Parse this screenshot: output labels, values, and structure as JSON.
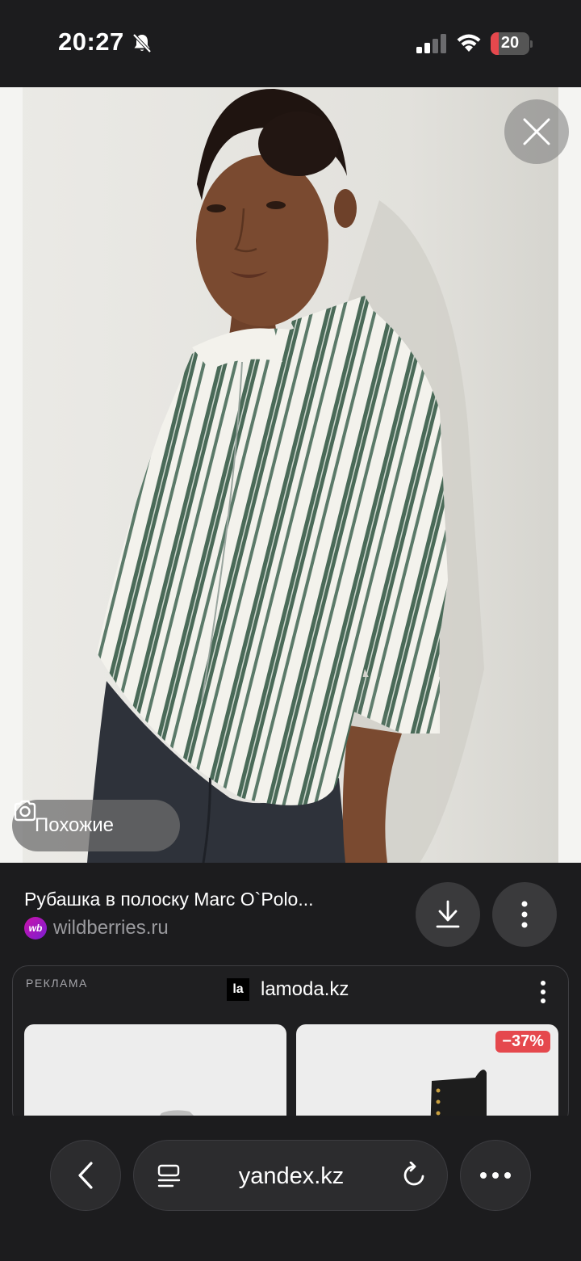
{
  "status_bar": {
    "time": "20:27",
    "battery_level": "20",
    "battery_fraction": 0.2
  },
  "image_viewer": {
    "close_icon": "close-icon",
    "similar_button_label": "Похожие"
  },
  "result": {
    "title": "Рубашка в полоску Marc O`Polo...",
    "source": "wildberries.ru",
    "source_logo": "wb"
  },
  "ad": {
    "label": "РЕКЛАМА",
    "brand_logo": "la",
    "brand_name": "lamoda.kz",
    "discount": "−37%"
  },
  "browser": {
    "url": "yandex.kz"
  },
  "colors": {
    "background": "#1c1c1e",
    "discount_badge": "#e5484d",
    "shirt_stripe": "#4a6a58"
  }
}
